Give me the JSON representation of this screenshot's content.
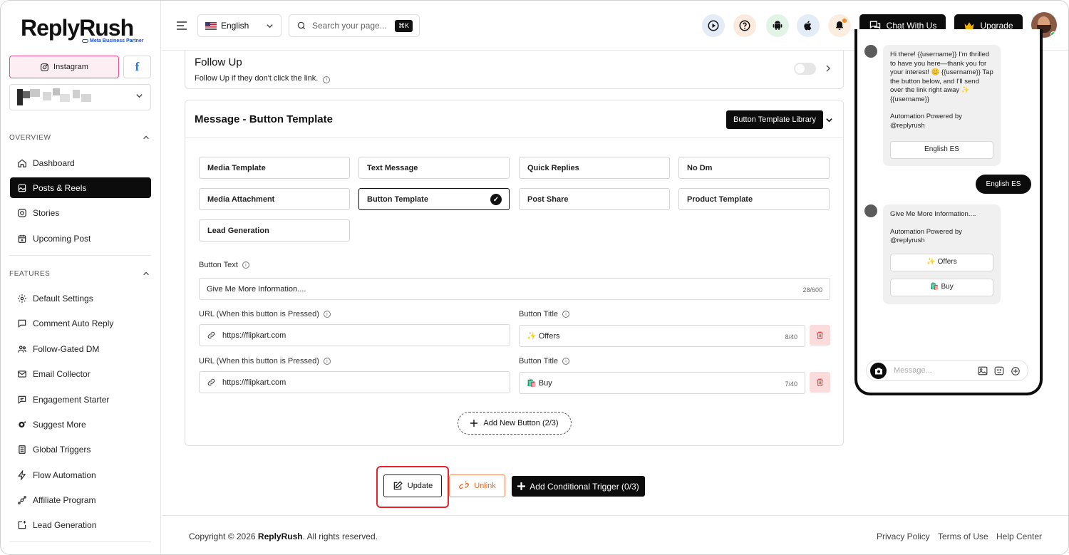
{
  "brand": {
    "name": "ReplyRush",
    "partner": "Meta Business Partner"
  },
  "sidebar": {
    "platforms": {
      "instagram": "Instagram",
      "facebook": "f"
    },
    "overview_label": "OVERVIEW",
    "overview_items": [
      "Dashboard",
      "Posts & Reels",
      "Stories",
      "Upcoming Post"
    ],
    "active_item": "Posts & Reels",
    "features_label": "FEATURES",
    "features_items": [
      "Default Settings",
      "Comment Auto Reply",
      "Follow-Gated DM",
      "Email Collector",
      "Engagement Starter",
      "Suggest More",
      "Global Triggers",
      "Flow Automation",
      "Affiliate Program",
      "Lead Generation"
    ]
  },
  "header": {
    "language": "English",
    "search_placeholder": "Search your page...",
    "search_shortcut": "⌘K",
    "chat_label": "Chat With Us",
    "upgrade_label": "Upgrade"
  },
  "follow_up": {
    "title": "Follow Up",
    "subtitle": "Follow Up if they don't click the link.",
    "enabled": false
  },
  "message_template": {
    "title": "Message - Button Template",
    "library_label": "Button Template Library",
    "templates": [
      "Media Template",
      "Text Message",
      "Quick Replies",
      "No Dm",
      "Media Attachment",
      "Button Template",
      "Post Share",
      "Product Template",
      "Lead Generation"
    ],
    "selected_template": "Button Template",
    "button_text_label": "Button Text",
    "button_text_value": "Give Me More Information....",
    "button_text_count": "28/600",
    "url_label": "URL (When this button is Pressed)",
    "title_label": "Button Title",
    "buttons": [
      {
        "url": "https://flipkart.com",
        "title": "✨ Offers",
        "count": "8/40"
      },
      {
        "url": "https://flipkart.com",
        "title": "🛍️ Buy",
        "count": "7/40"
      }
    ],
    "add_button_label": "Add New Button (2/3)"
  },
  "actions": {
    "update": "Update",
    "unlink": "Unlink",
    "conditional": "Add Conditional Trigger (0/3)"
  },
  "footer": {
    "copyright_prefix": "Copyright © 2026",
    "copyright_brand": "ReplyRush",
    "copyright_suffix": ". All rights reserved.",
    "links": [
      "Privacy Policy",
      "Terms of Use",
      "Help Center"
    ]
  },
  "preview": {
    "messages": [
      {
        "text": "Hi there! {{username}} I'm thrilled to have you here—thank you for your interest! 😊 {{username}} Tap the button below, and I'll send over the link right away ✨ {{username}}",
        "powered": "Automation Powered by @replyrush",
        "buttons": [
          "English ES"
        ]
      },
      {
        "user_reply": "English ES"
      },
      {
        "text": "Give Me More Information....",
        "powered": "Automation Powered by @replyrush",
        "buttons": [
          "✨ Offers",
          "🛍️ Buy"
        ]
      }
    ],
    "input_placeholder": "Message..."
  },
  "colors": {
    "accent": "#0c0c0c",
    "instagram": "#ec4d8c",
    "facebook": "#1877f2",
    "highlight": "#e8222a",
    "unlink": "#e8692a",
    "danger_bg": "#fbdcdc",
    "danger_icon": "#e24a4a"
  }
}
